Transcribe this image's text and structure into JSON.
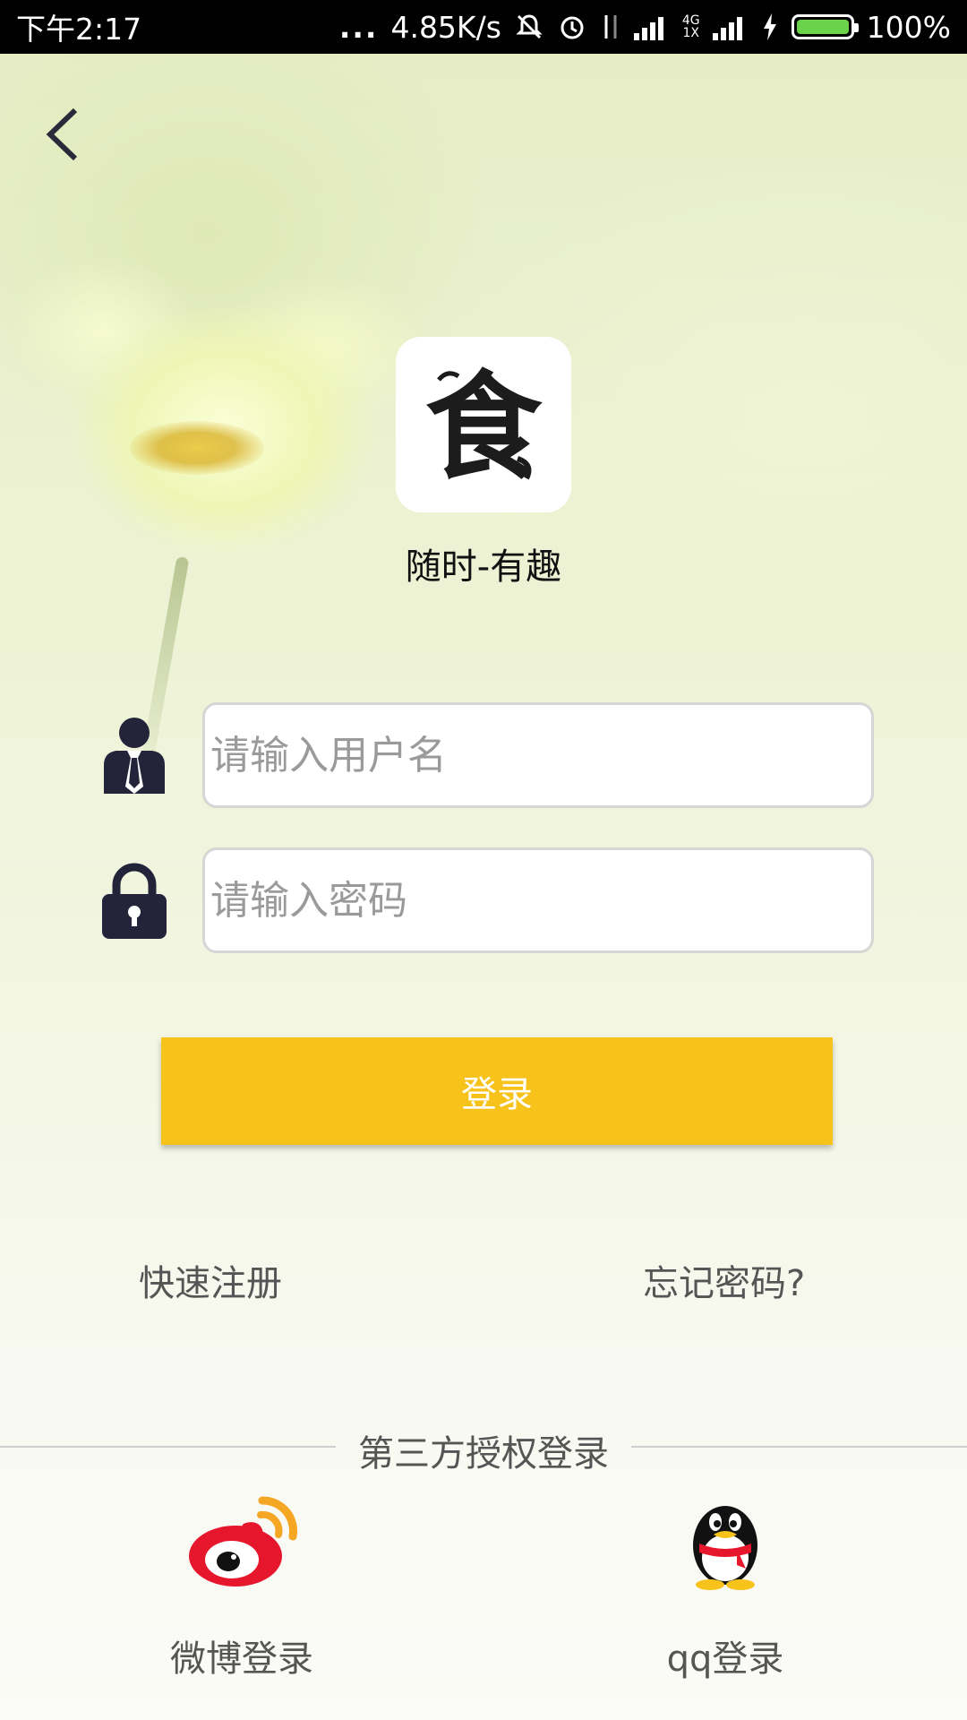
{
  "status_bar": {
    "time": "下午2:17",
    "dots": "...",
    "speed": "4.85K/s",
    "network_4g": "4G",
    "network_1x": "1X",
    "battery": "100%"
  },
  "app": {
    "name": "随时-有趣",
    "logo_glyph": "食"
  },
  "form": {
    "username_placeholder": "请输入用户名",
    "password_placeholder": "请输入密码",
    "login_label": "登录"
  },
  "links": {
    "register": "快速注册",
    "forgot": "忘记密码?"
  },
  "third_party": {
    "title": "第三方授权登录",
    "weibo_label": "微博登录",
    "qq_label": "qq登录"
  },
  "colors": {
    "accent": "#f7c21a",
    "weibo_red": "#e6162d",
    "weibo_orange": "#f5a623"
  }
}
